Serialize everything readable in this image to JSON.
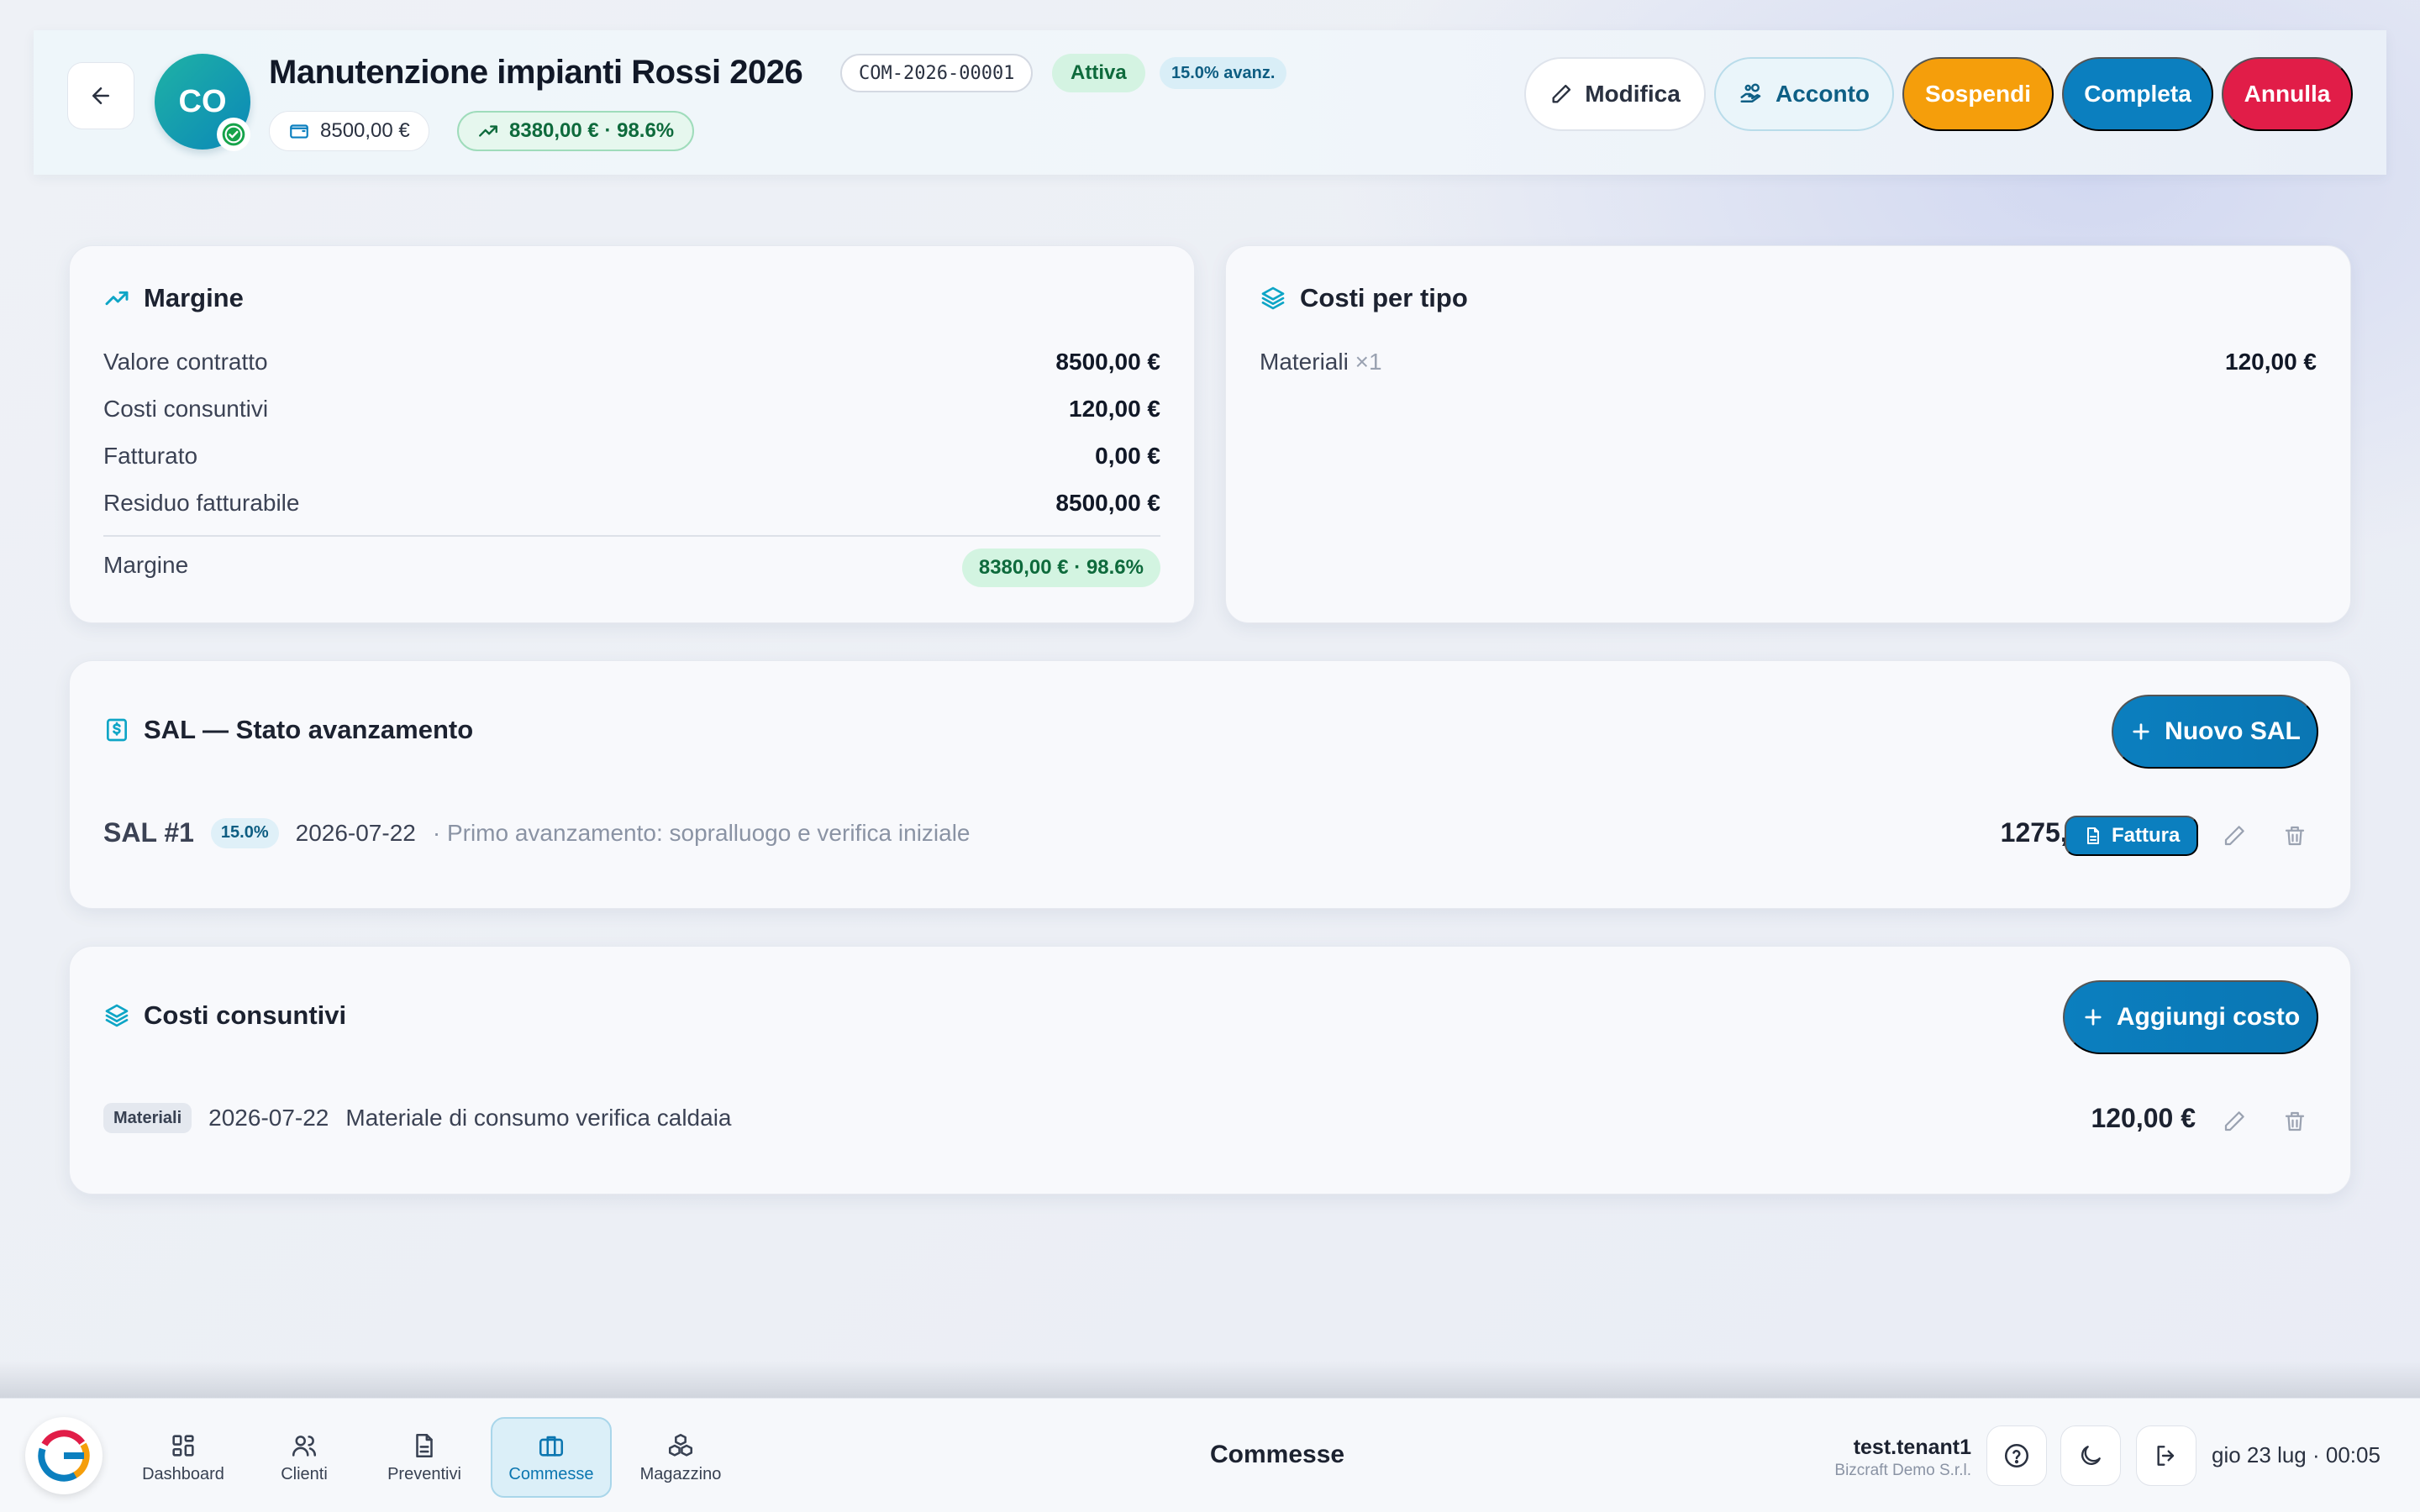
{
  "header": {
    "avatar_initials": "CO",
    "title": "Manutenzione impianti Rossi 2026",
    "code": "COM-2026-00001",
    "status": "Attiva",
    "progress_label": "15.0% avanz.",
    "contract_value": "8500,00 €",
    "margin_summary": "8380,00 € · 98.6%",
    "buttons": {
      "edit": "Modifica",
      "deposit": "Acconto",
      "suspend": "Sospendi",
      "complete": "Completa",
      "cancel": "Annulla"
    }
  },
  "margin_card": {
    "title": "Margine",
    "rows": [
      {
        "label": "Valore contratto",
        "value": "8500,00 €"
      },
      {
        "label": "Costi consuntivi",
        "value": "120,00 €"
      },
      {
        "label": "Fatturato",
        "value": "0,00 €"
      },
      {
        "label": "Residuo fatturabile",
        "value": "8500,00 €"
      }
    ],
    "margin_label": "Margine",
    "margin_value": "8380,00 € · 98.6%"
  },
  "cost_type_card": {
    "title": "Costi per tipo",
    "rows": [
      {
        "label": "Materiali",
        "count": "×1",
        "value": "120,00 €"
      }
    ]
  },
  "sal_card": {
    "title": "SAL — Stato avanzamento",
    "new_button": "Nuovo SAL",
    "items": [
      {
        "name": "SAL #1",
        "percent": "15.0%",
        "date": "2026-07-22",
        "description": "· Primo avanzamento: sopralluogo e verifica iniziale",
        "amount": "1275,00 €",
        "invoice_label": "Fattura"
      }
    ]
  },
  "costs_card": {
    "title": "Costi consuntivi",
    "add_button": "Aggiungi costo",
    "items": [
      {
        "category": "Materiali",
        "date": "2026-07-22",
        "description": "Materiale di consumo verifica caldaia",
        "amount": "120,00 €"
      }
    ]
  },
  "bottom_nav": {
    "items": [
      {
        "label": "Dashboard"
      },
      {
        "label": "Clienti"
      },
      {
        "label": "Preventivi"
      },
      {
        "label": "Commesse"
      },
      {
        "label": "Magazzino"
      }
    ],
    "active": "Commesse",
    "center_title": "Commesse",
    "user": "test.tenant1",
    "company": "Bizcraft Demo S.r.l.",
    "datetime": "gio 23 lug · 00:05"
  },
  "colors": {
    "primary": "#0b7fbf",
    "warning": "#f59e0b",
    "danger": "#e11d48",
    "success": "#0e6a3c"
  }
}
